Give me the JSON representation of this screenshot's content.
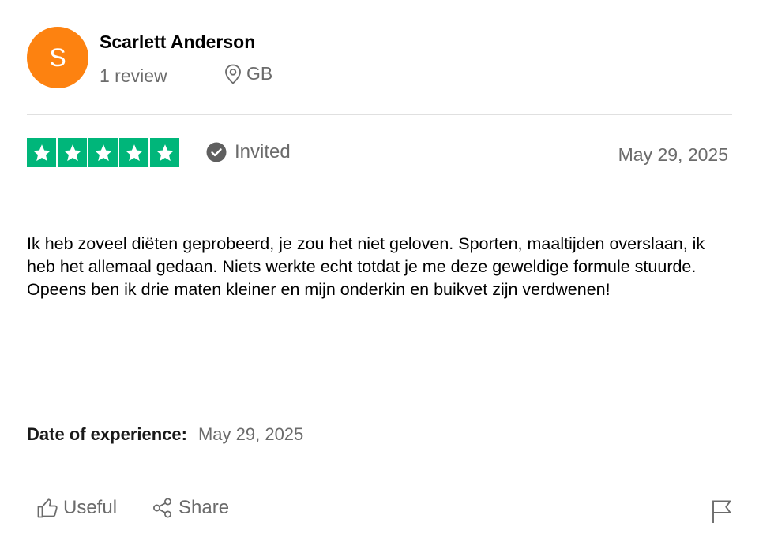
{
  "reviewer": {
    "avatar_initial": "S",
    "avatar_color": "#fd8210",
    "name": "Scarlett Anderson",
    "review_count": "1 review",
    "country": "GB"
  },
  "review": {
    "rating": 5,
    "rating_color": "#00b67a",
    "invited_label": "Invited",
    "date": "May 29, 2025",
    "text": "Ik heb zoveel diëten geprobeerd, je zou het niet geloven. Sporten, maaltijden overslaan, ik heb het allemaal gedaan. Niets werkte echt totdat je me deze geweldige formule stuurde. Opeens ben ik drie maten kleiner en mijn onderkin en buikvet zijn verdwenen!",
    "experience_label": "Date of experience:",
    "experience_date": "May 29, 2025"
  },
  "actions": {
    "useful_label": "Useful",
    "share_label": "Share",
    "report_icon": "flag-icon"
  },
  "icons": {
    "location": "location-pin-icon",
    "invited": "check-circle-icon",
    "useful": "thumbs-up-icon",
    "share": "share-icon",
    "star": "star-icon"
  }
}
